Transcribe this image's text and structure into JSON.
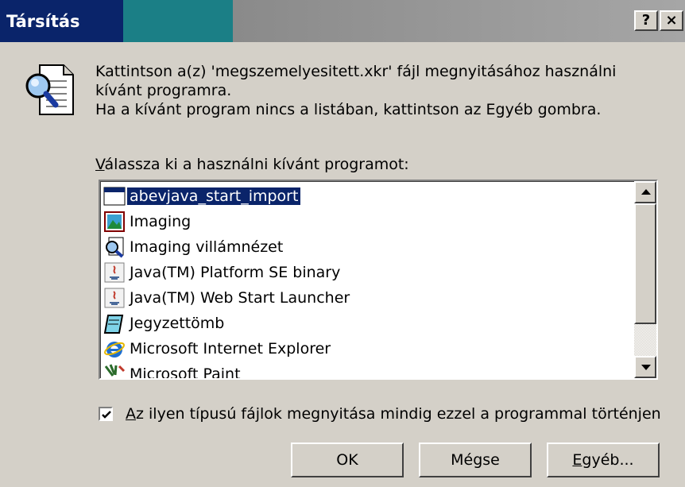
{
  "window": {
    "title": "Társítás",
    "help_label": "?",
    "close_label": "×"
  },
  "message": {
    "line1": "Kattintson a(z) 'megszemelyesitett.xkr' fájl megnyitásához használni kívánt programra.",
    "line2": "Ha a kívánt program nincs a listában, kattintson az Egyéb gombra."
  },
  "list": {
    "label_accel": "V",
    "label_rest": "álassza ki a használni kívánt programot:",
    "items": [
      {
        "label": "abevjava_start_import",
        "icon": "blank-app-icon",
        "selected": true
      },
      {
        "label": "Imaging",
        "icon": "imaging-icon",
        "selected": false
      },
      {
        "label": "Imaging villámnézet",
        "icon": "imaging-preview-icon",
        "selected": false
      },
      {
        "label": "Java(TM) Platform SE binary",
        "icon": "java-icon",
        "selected": false
      },
      {
        "label": "Java(TM) Web Start Launcher",
        "icon": "java-icon",
        "selected": false
      },
      {
        "label": "Jegyzettömb",
        "icon": "notepad-icon",
        "selected": false
      },
      {
        "label": "Microsoft Internet Explorer",
        "icon": "ie-icon",
        "selected": false
      },
      {
        "label": "Microsoft Paint",
        "icon": "paint-icon",
        "selected": false
      }
    ]
  },
  "checkbox": {
    "checked": true,
    "label_accel": "A",
    "label_rest": "z ilyen típusú fájlok megnyitása mindig ezzel a programmal történjen"
  },
  "buttons": {
    "ok": "OK",
    "cancel": "Mégse",
    "other_accel": "E",
    "other_rest": "gyéb..."
  },
  "colors": {
    "selection": "#0a246a",
    "dialog": "#d4d0c8"
  }
}
